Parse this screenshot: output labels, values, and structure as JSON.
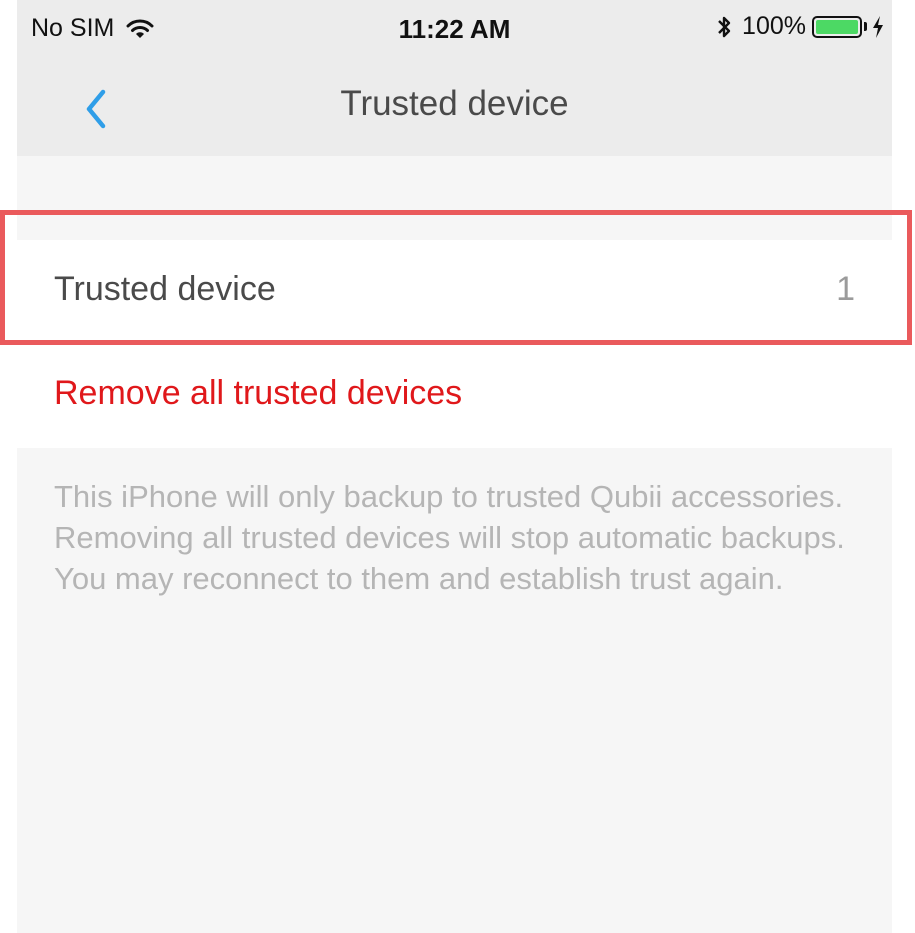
{
  "status_bar": {
    "carrier": "No SIM",
    "time": "11:22 AM",
    "battery_percent": "100%",
    "battery_level": 1.0,
    "icons": [
      "wifi-icon",
      "bluetooth-icon",
      "battery-icon",
      "charging-bolt-icon"
    ]
  },
  "nav": {
    "back_icon": "chevron-left-icon",
    "title": "Trusted device"
  },
  "list": {
    "trusted_device": {
      "label": "Trusted device",
      "value": "1"
    },
    "remove_label": "Remove all trusted devices"
  },
  "footer_note": "This iPhone will only backup to trusted Qubii accessories. Removing all trusted devices will stop automatic backups. You may reconnect to them and establish trust again.",
  "colors": {
    "accent": "#2f9ee8",
    "destructive": "#e0181b",
    "highlight": "#ea5a5c",
    "battery": "#4cd964"
  }
}
